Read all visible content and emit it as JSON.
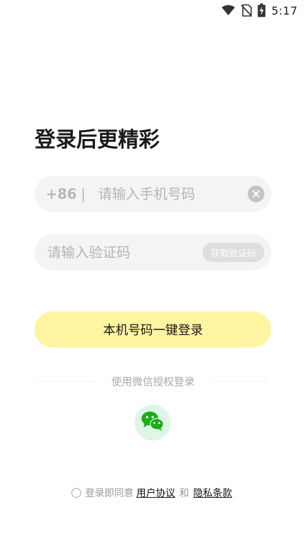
{
  "status_bar": {
    "time": "5:17",
    "icons": [
      "wifi-icon",
      "no-sim-icon",
      "battery-charging-icon"
    ]
  },
  "title": "登录后更精彩",
  "phone_field": {
    "country_code": "+86",
    "separator": "|",
    "placeholder": "请输入手机号码",
    "value": "",
    "clear_icon": "clear-icon"
  },
  "code_field": {
    "placeholder": "请输入验证码",
    "value": "",
    "get_code_label": "获取验证码"
  },
  "one_click_login_label": "本机号码一键登录",
  "wechat_login": {
    "label": "使用微信授权登录",
    "icon": "wechat-icon"
  },
  "agreement": {
    "prefix": "登录即同意",
    "user_agreement": "用户协议",
    "and": "和",
    "privacy_policy": "隐私条款"
  },
  "colors": {
    "login_button": "#fff4a2",
    "field_background": "#f4f4f4",
    "wechat_green": "#1aad19",
    "wechat_bg": "#dff5e5"
  }
}
